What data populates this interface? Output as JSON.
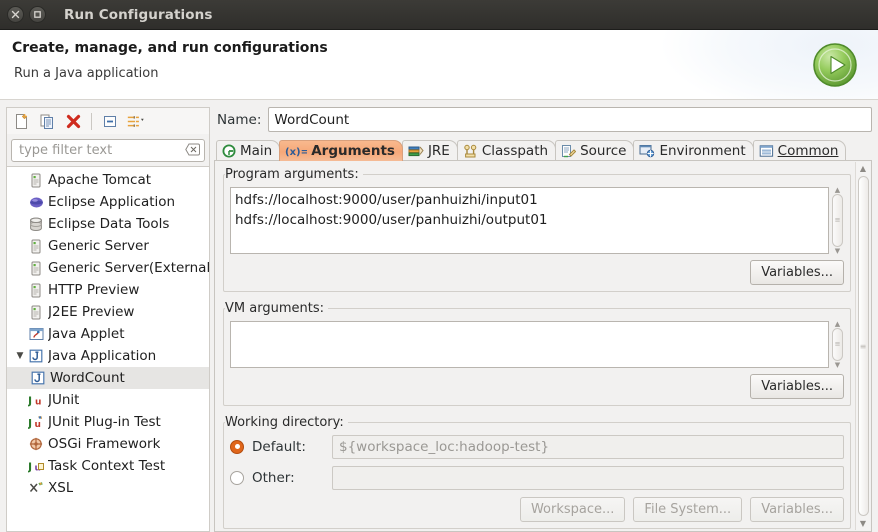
{
  "window": {
    "title": "Run Configurations",
    "close_icon": "close-icon",
    "maximize_icon": "maximize-icon"
  },
  "banner": {
    "title": "Create, manage, and run configurations",
    "subtitle": "Run a Java application",
    "run_icon": "run-play-icon",
    "accent_green": "#7ab648"
  },
  "tree_toolbar": {
    "buttons": [
      {
        "name": "new-configuration-button",
        "icon": "new-document-icon"
      },
      {
        "name": "duplicate-configuration-button",
        "icon": "copy-icon"
      },
      {
        "name": "delete-configuration-button",
        "icon": "delete-x-icon"
      },
      {
        "name": "collapse-all-button",
        "icon": "collapse-all-icon"
      },
      {
        "name": "filter-menu-button",
        "icon": "filter-arrows-icon"
      }
    ]
  },
  "filter": {
    "placeholder": "type filter text",
    "value": "",
    "clear_icon": "clear-icon"
  },
  "tree": {
    "items": [
      {
        "label": "Apache Tomcat",
        "icon": "server-icon",
        "indent": false,
        "twisty": "",
        "selected": false
      },
      {
        "label": "Eclipse Application",
        "icon": "eclipse-sphere-icon",
        "indent": false,
        "twisty": "",
        "selected": false
      },
      {
        "label": "Eclipse Data Tools",
        "icon": "database-icon",
        "indent": false,
        "twisty": "",
        "selected": false
      },
      {
        "label": "Generic Server",
        "icon": "server-icon",
        "indent": false,
        "twisty": "",
        "selected": false
      },
      {
        "label": "Generic Server(External",
        "icon": "server-icon",
        "indent": false,
        "twisty": "",
        "selected": false
      },
      {
        "label": "HTTP Preview",
        "icon": "server-icon",
        "indent": false,
        "twisty": "",
        "selected": false
      },
      {
        "label": "J2EE Preview",
        "icon": "server-icon",
        "indent": false,
        "twisty": "",
        "selected": false
      },
      {
        "label": "Java Applet",
        "icon": "java-applet-icon",
        "indent": false,
        "twisty": "",
        "selected": false
      },
      {
        "label": "Java Application",
        "icon": "java-application-icon",
        "indent": false,
        "twisty": "▼",
        "selected": false
      },
      {
        "label": "WordCount",
        "icon": "java-application-icon",
        "indent": true,
        "twisty": "",
        "selected": true
      },
      {
        "label": "JUnit",
        "icon": "junit-icon",
        "indent": false,
        "twisty": "",
        "selected": false
      },
      {
        "label": "JUnit Plug-in Test",
        "icon": "junit-plugin-icon",
        "indent": false,
        "twisty": "",
        "selected": false
      },
      {
        "label": "OSGi Framework",
        "icon": "osgi-icon",
        "indent": false,
        "twisty": "",
        "selected": false
      },
      {
        "label": "Task Context Test",
        "icon": "task-context-icon",
        "indent": false,
        "twisty": "",
        "selected": false
      },
      {
        "label": "XSL",
        "icon": "xsl-icon",
        "indent": false,
        "twisty": "",
        "selected": false
      }
    ]
  },
  "name_field": {
    "label": "Name:",
    "value": "WordCount"
  },
  "tabs": [
    {
      "label": "Main",
      "icon": "main-circle-icon",
      "active": false
    },
    {
      "label": "Arguments",
      "icon": "arguments-icon",
      "active": true
    },
    {
      "label": "JRE",
      "icon": "jre-books-icon",
      "active": false
    },
    {
      "label": "Classpath",
      "icon": "classpath-icon",
      "active": false
    },
    {
      "label": "Source",
      "icon": "source-icon",
      "active": false
    },
    {
      "label": "Environment",
      "icon": "environment-icon",
      "active": false
    },
    {
      "label": "Common",
      "icon": "common-icon",
      "active": false
    }
  ],
  "program_arguments": {
    "legend": "Program arguments:",
    "value": "hdfs://localhost:9000/user/panhuizhi/input01 hdfs://localhost:9000/user/panhuizhi/output01",
    "variables_button": "Variables..."
  },
  "vm_arguments": {
    "legend": "VM arguments:",
    "value": "",
    "variables_button": "Variables..."
  },
  "working_directory": {
    "legend": "Working directory:",
    "default_label": "Default:",
    "default_value": "${workspace_loc:hadoop-test}",
    "default_selected": true,
    "other_label": "Other:",
    "other_value": "",
    "other_selected": false,
    "workspace_button": "Workspace...",
    "filesystem_button": "File System...",
    "variables_button": "Variables..."
  }
}
